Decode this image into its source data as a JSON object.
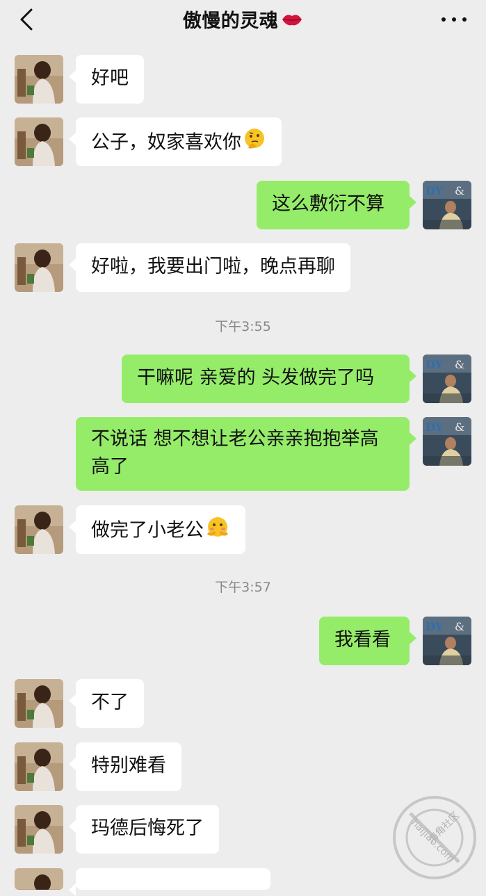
{
  "header": {
    "title": "傲慢的灵魂",
    "title_emoji_icon": "kiss-lips-icon",
    "back_icon": "back-chevron-icon",
    "more_icon": "more-dots-icon"
  },
  "messages": [
    {
      "side": "left",
      "text": "好吧"
    },
    {
      "side": "left",
      "text": "公子，奴家喜欢你",
      "emoji": "thinking-face-icon"
    },
    {
      "side": "right",
      "text": "这么敷衍不算"
    },
    {
      "side": "left",
      "text": "好啦，我要出门啦，晚点再聊"
    },
    {
      "side": "right",
      "text": "干嘛呢 亲爱的 头发做完了吗"
    },
    {
      "side": "right",
      "text": "不说话 想不想让老公亲亲抱抱举高高了"
    },
    {
      "side": "left",
      "text": "做完了小老公",
      "emoji": "shy-face-icon"
    },
    {
      "side": "right",
      "text": "我看看"
    },
    {
      "side": "left",
      "text": "不了"
    },
    {
      "side": "left",
      "text": "特别难看"
    },
    {
      "side": "left",
      "text": "玛德后悔死了"
    }
  ],
  "timestamps": [
    "下午3:55",
    "下午3:57"
  ],
  "watermark": {
    "line1": "海角社区",
    "line2": "haijiao.com"
  },
  "colors": {
    "background": "#ededed",
    "bubble_self": "#95ec69",
    "bubble_other": "#ffffff"
  }
}
